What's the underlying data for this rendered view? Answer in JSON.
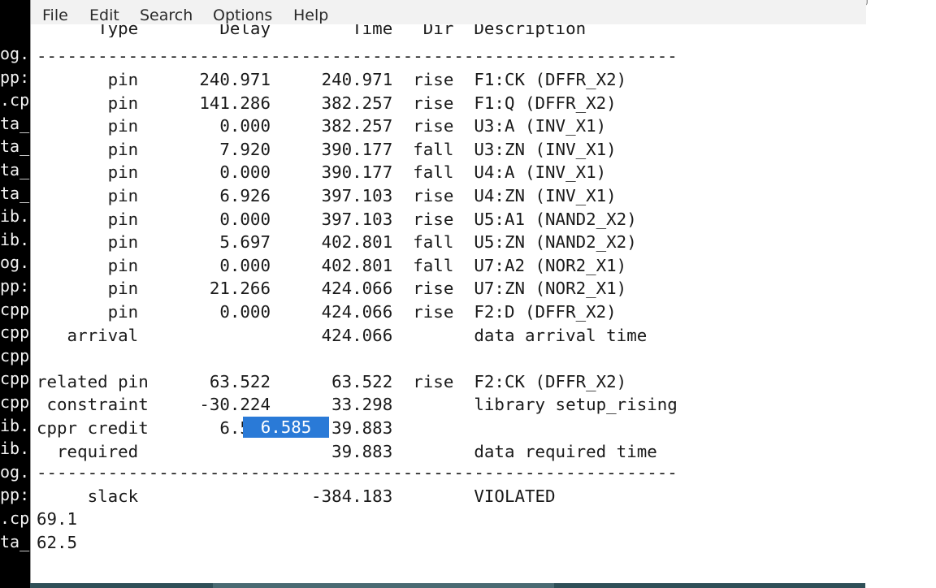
{
  "background_terminal": {
    "lines": [
      "og.",
      "pp:",
      ".cp",
      "ta_",
      "ta_",
      "ta_",
      "ta_",
      "ib.",
      "ib.",
      "og.",
      "pp:",
      "cpp",
      "cpp",
      "cpp",
      "cpp",
      "cpp",
      "ib.",
      "ib.",
      "og.",
      "pp:",
      ".cp",
      "ta_"
    ]
  },
  "menubar": {
    "items": [
      "File",
      "Edit",
      "Search",
      "Options",
      "Help"
    ]
  },
  "report": {
    "header": "      Type        Delay        Time   Dir  Description",
    "separator": "---------------------------------------------------------------",
    "rows": [
      "       pin      240.971     240.971  rise  F1:CK (DFFR_X2)",
      "       pin      141.286     382.257  rise  F1:Q (DFFR_X2)",
      "       pin        0.000     382.257  rise  U3:A (INV_X1)",
      "       pin        7.920     390.177  fall  U3:ZN (INV_X1)",
      "       pin        0.000     390.177  fall  U4:A (INV_X1)",
      "       pin        6.926     397.103  rise  U4:ZN (INV_X1)",
      "       pin        0.000     397.103  rise  U5:A1 (NAND2_X2)",
      "       pin        5.697     402.801  fall  U5:ZN (NAND2_X2)",
      "       pin        0.000     402.801  fall  U7:A2 (NOR2_X1)",
      "       pin       21.266     424.066  rise  U7:ZN (NOR2_X1)",
      "       pin        0.000     424.066  rise  F2:D (DFFR_X2)",
      "   arrival                  424.066        data arrival time",
      "",
      "related pin      63.522      63.522  rise  F2:CK (DFFR_X2)",
      " constraint     -30.224      33.298        library setup_rising",
      "cppr credit       6.585      39.883",
      "  required                   39.883        data required time"
    ],
    "separator2": "---------------------------------------------------------------",
    "slack": "     slack                 -384.183        VIOLATED",
    "extra": [
      "69.1",
      "62.5"
    ],
    "selection": "6.585"
  }
}
